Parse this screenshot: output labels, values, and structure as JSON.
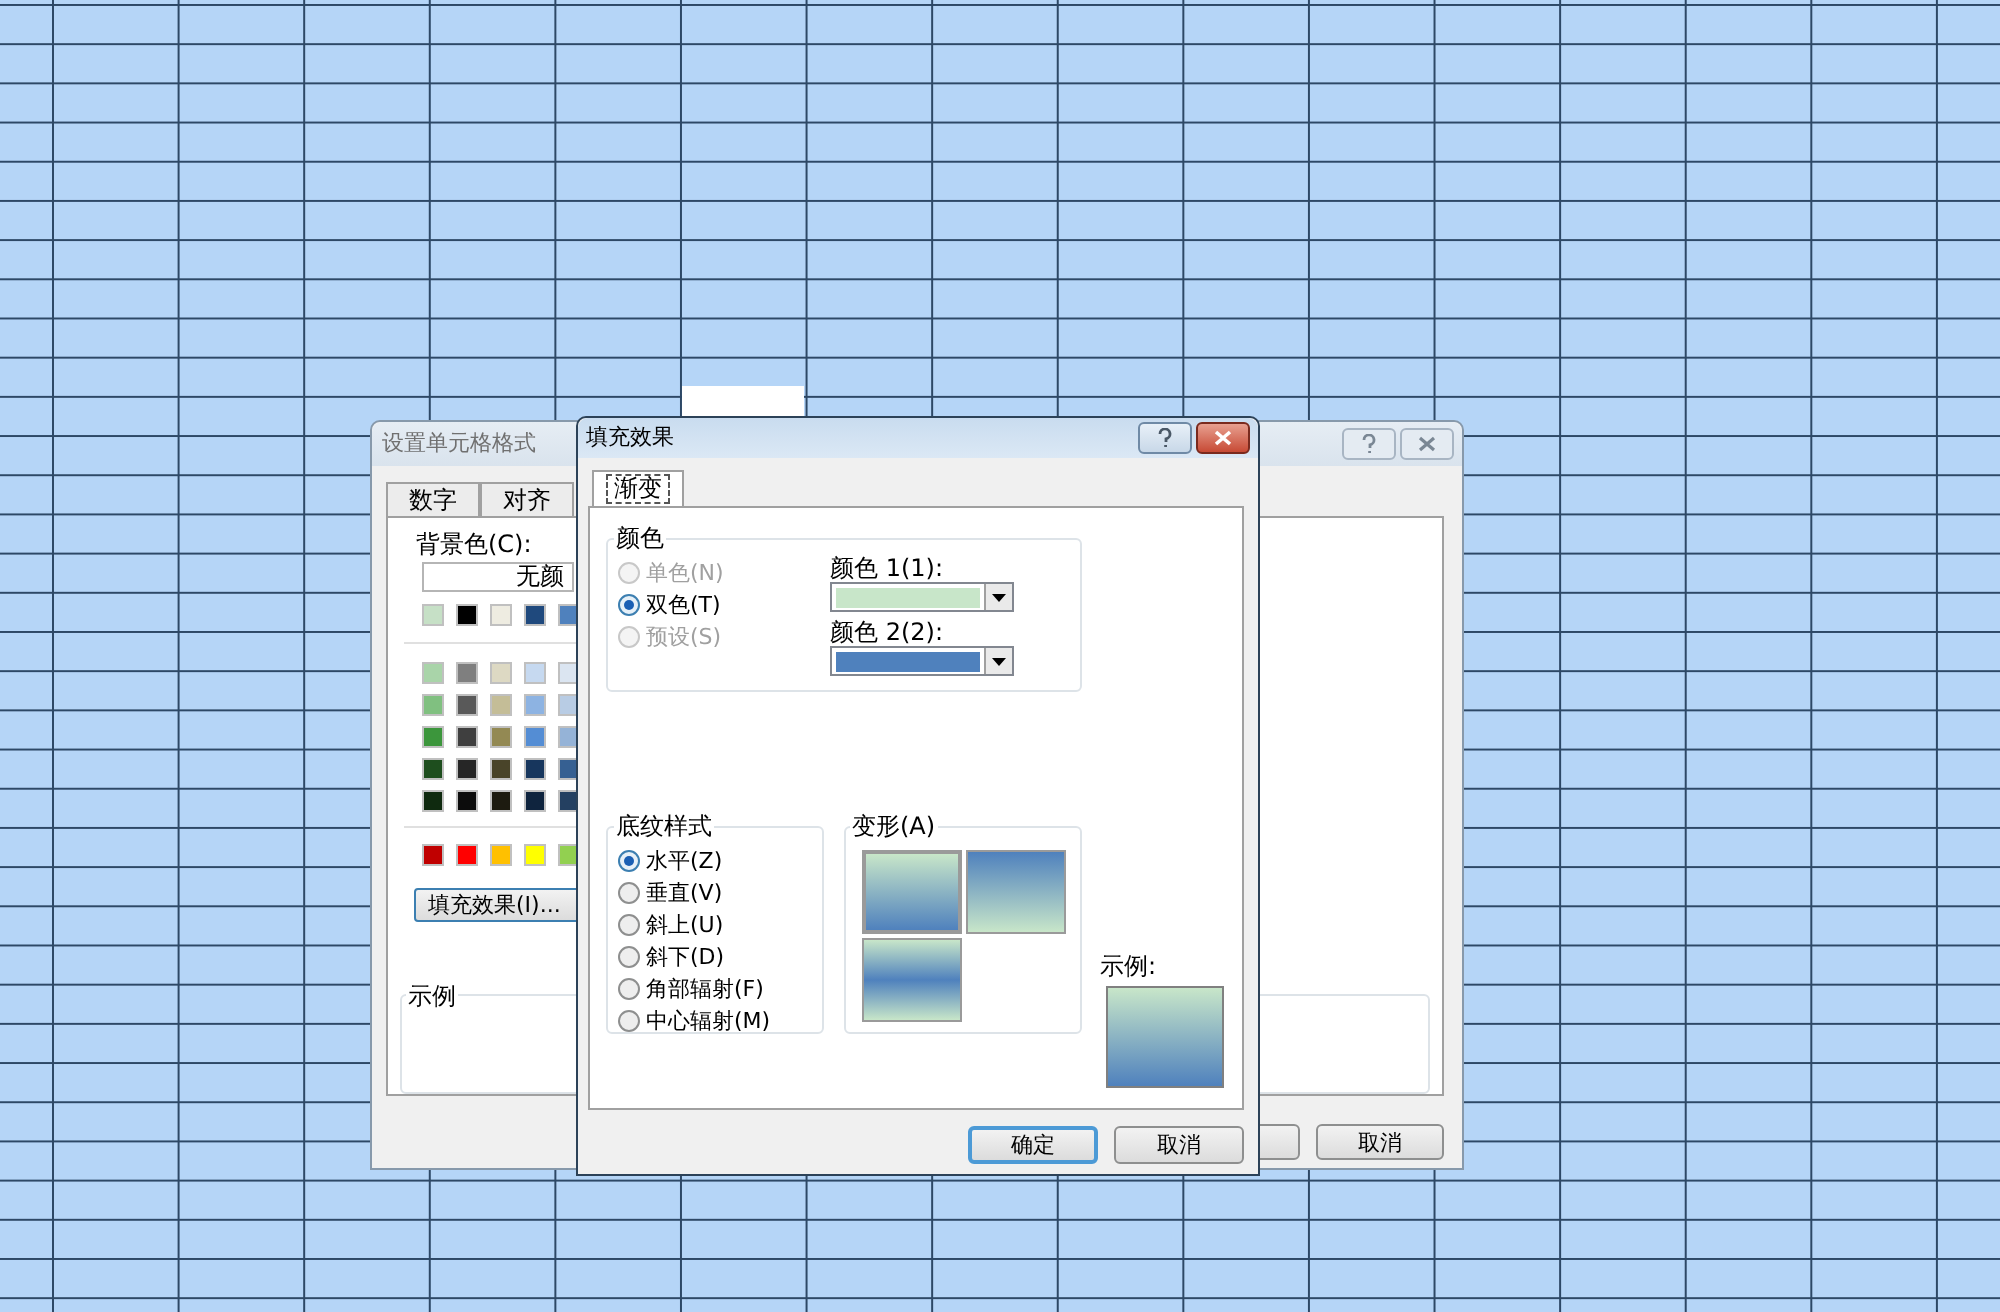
{
  "back_dialog": {
    "title": "设置单元格格式",
    "tabs": [
      {
        "label": "数字",
        "selected": false
      },
      {
        "label": "对齐",
        "selected": false
      }
    ],
    "background_color_label": "背景色(C):",
    "no_color_field": "无颜",
    "swatch_rows": [
      [
        {
          "color": "#c6e0c6"
        },
        {
          "color": "#000000"
        },
        {
          "color": "#eeece1"
        },
        {
          "color": "#1f497d"
        },
        {
          "color": "#4f81bd"
        }
      ],
      [
        {
          "color": "#a9d4a9"
        },
        {
          "color": "#7f7f7f"
        },
        {
          "color": "#ddd9c3"
        },
        {
          "color": "#c6d9f0"
        },
        {
          "color": "#dbe5f1"
        }
      ],
      [
        {
          "color": "#80c080"
        },
        {
          "color": "#595959"
        },
        {
          "color": "#c4bd97"
        },
        {
          "color": "#8db3e2"
        },
        {
          "color": "#b8cce4"
        }
      ],
      [
        {
          "color": "#3c963c"
        },
        {
          "color": "#3f3f3f"
        },
        {
          "color": "#938953"
        },
        {
          "color": "#548dd4"
        },
        {
          "color": "#95b3d7"
        }
      ],
      [
        {
          "color": "#1e4e1e"
        },
        {
          "color": "#262626"
        },
        {
          "color": "#494429"
        },
        {
          "color": "#17365d"
        },
        {
          "color": "#366092"
        }
      ],
      [
        {
          "color": "#0f2a0f"
        },
        {
          "color": "#0c0c0c"
        },
        {
          "color": "#1d1b10"
        },
        {
          "color": "#0f243e"
        },
        {
          "color": "#244061"
        }
      ]
    ],
    "accent_swatches": [
      {
        "color": "#c00000"
      },
      {
        "color": "#ff0000"
      },
      {
        "color": "#ffc000"
      },
      {
        "color": "#ffff00"
      },
      {
        "color": "#92d050"
      }
    ],
    "fill_effects_button": "填充效果(I)...",
    "sample_label": "示例",
    "cancel_button": "取消"
  },
  "fill_dialog": {
    "title": "填充效果",
    "tabs": [
      {
        "label": "渐变",
        "selected": true
      }
    ],
    "colors_group": {
      "title": "颜色",
      "options": [
        {
          "label": "单色(N)",
          "selected": false,
          "disabled": true
        },
        {
          "label": "双色(T)",
          "selected": true,
          "disabled": false
        },
        {
          "label": "预设(S)",
          "selected": false,
          "disabled": true
        }
      ],
      "color1": {
        "label": "颜色 1(1):",
        "color": "#c8e6c9"
      },
      "color2": {
        "label": "颜色 2(2):",
        "color": "#4f81bd"
      }
    },
    "shading_group": {
      "title": "底纹样式",
      "options": [
        {
          "label": "水平(Z)",
          "selected": true
        },
        {
          "label": "垂直(V)",
          "selected": false
        },
        {
          "label": "斜上(U)",
          "selected": false
        },
        {
          "label": "斜下(D)",
          "selected": false
        },
        {
          "label": "角部辐射(F)",
          "selected": false
        },
        {
          "label": "中心辐射(M)",
          "selected": false
        }
      ]
    },
    "variants": {
      "title": "变形(A)",
      "items": [
        {
          "kind": "down",
          "selected": true
        },
        {
          "kind": "up",
          "selected": false
        },
        {
          "kind": "middle",
          "selected": false
        }
      ]
    },
    "sample_label": "示例:",
    "buttons": [
      {
        "label": "确定",
        "default": true
      },
      {
        "label": "取消",
        "default": false
      }
    ]
  }
}
